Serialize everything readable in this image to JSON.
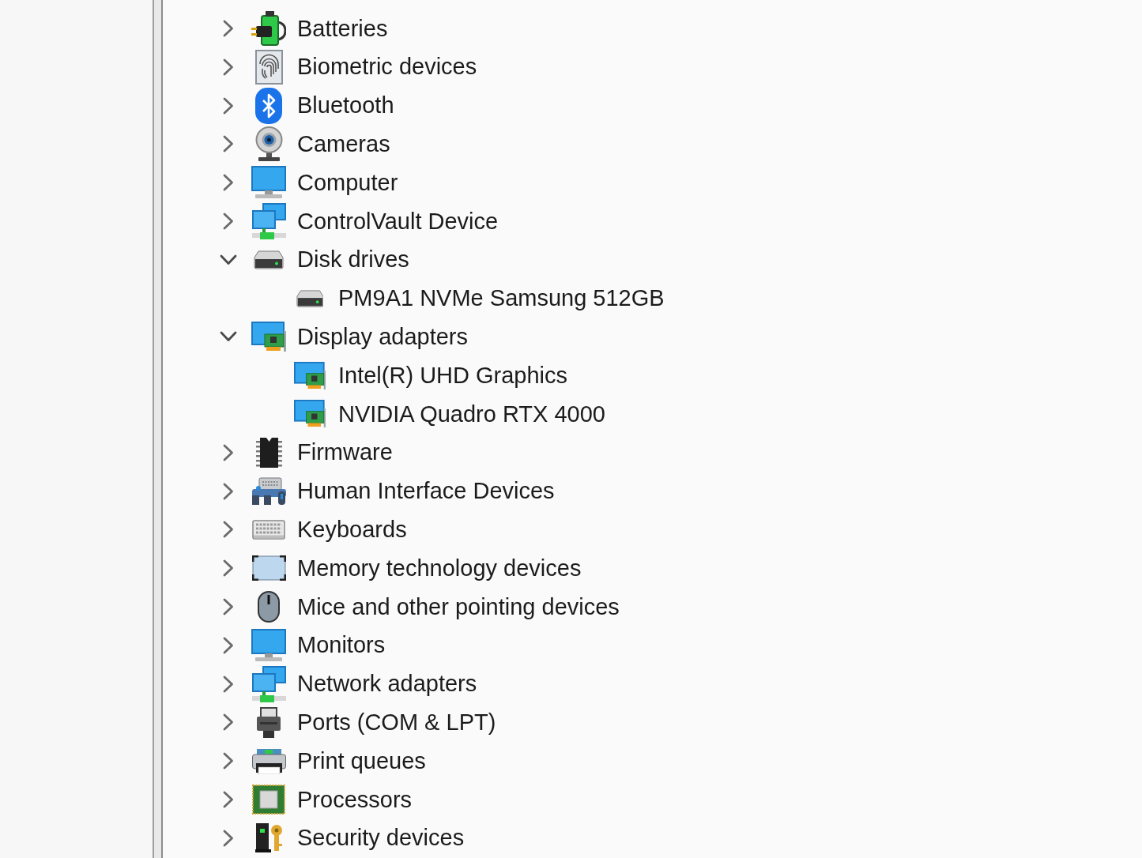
{
  "tree": {
    "items": [
      {
        "label": "Batteries",
        "expanded": false
      },
      {
        "label": "Biometric devices",
        "expanded": false
      },
      {
        "label": "Bluetooth",
        "expanded": false
      },
      {
        "label": "Cameras",
        "expanded": false
      },
      {
        "label": "Computer",
        "expanded": false
      },
      {
        "label": "ControlVault Device",
        "expanded": false
      },
      {
        "label": "Disk drives",
        "expanded": true,
        "children": [
          {
            "label": "PM9A1 NVMe Samsung 512GB"
          }
        ]
      },
      {
        "label": "Display adapters",
        "expanded": true,
        "children": [
          {
            "label": "Intel(R) UHD Graphics"
          },
          {
            "label": "NVIDIA Quadro RTX 4000"
          }
        ]
      },
      {
        "label": "Firmware",
        "expanded": false
      },
      {
        "label": "Human Interface Devices",
        "expanded": false
      },
      {
        "label": "Keyboards",
        "expanded": false
      },
      {
        "label": "Memory technology devices",
        "expanded": false
      },
      {
        "label": "Mice and other pointing devices",
        "expanded": false
      },
      {
        "label": "Monitors",
        "expanded": false
      },
      {
        "label": "Network adapters",
        "expanded": false
      },
      {
        "label": "Ports (COM & LPT)",
        "expanded": false
      },
      {
        "label": "Print queues",
        "expanded": false
      },
      {
        "label": "Processors",
        "expanded": false
      },
      {
        "label": "Security devices",
        "expanded": false
      }
    ]
  }
}
